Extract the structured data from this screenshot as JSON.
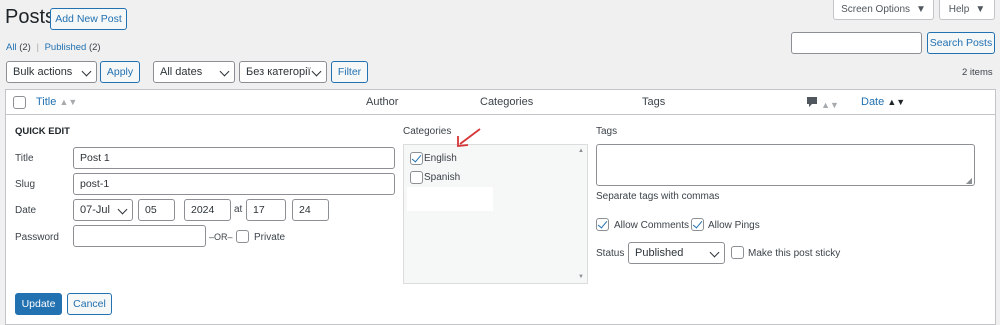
{
  "page": {
    "title": "Posts",
    "add_new": "Add New Post"
  },
  "screen_options": {
    "screen": "Screen Options",
    "help": "Help"
  },
  "subsubsub": {
    "all": "All",
    "all_count": "(2)",
    "sep": "|",
    "published": "Published",
    "published_count": "(2)"
  },
  "search": {
    "value": "",
    "button": "Search Posts"
  },
  "tablenav": {
    "bulk_action": "Bulk actions",
    "apply": "Apply",
    "dates": "All dates",
    "category": "Без категорії",
    "filter": "Filter",
    "items_count": "2 items"
  },
  "table": {
    "headers": {
      "title": "Title",
      "author": "Author",
      "categories": "Categories",
      "tags": "Tags",
      "date": "Date"
    }
  },
  "quick_edit": {
    "heading": "QUICK EDIT",
    "title_label": "Title",
    "title_value": "Post 1",
    "slug_label": "Slug",
    "slug_value": "post-1",
    "date_label": "Date",
    "month": "07-Jul",
    "day": "05",
    "year": "2024",
    "at": "at",
    "hour": "17",
    "minute": "24",
    "password_label": "Password",
    "password_value": "",
    "or": "–OR–",
    "private_label": "Private",
    "categories_label": "Categories",
    "categories": [
      {
        "name": "English",
        "checked": true
      },
      {
        "name": "Spanish",
        "checked": false
      }
    ],
    "tags_label": "Tags",
    "tags_value": "",
    "tags_hint": "Separate tags with commas",
    "allow_comments": "Allow Comments",
    "allow_pings": "Allow Pings",
    "status_label": "Status",
    "status_value": "Published",
    "sticky_label": "Make this post sticky",
    "update": "Update",
    "cancel": "Cancel"
  },
  "colors": {
    "accent": "#2271b1",
    "arrow": "#d63638"
  }
}
